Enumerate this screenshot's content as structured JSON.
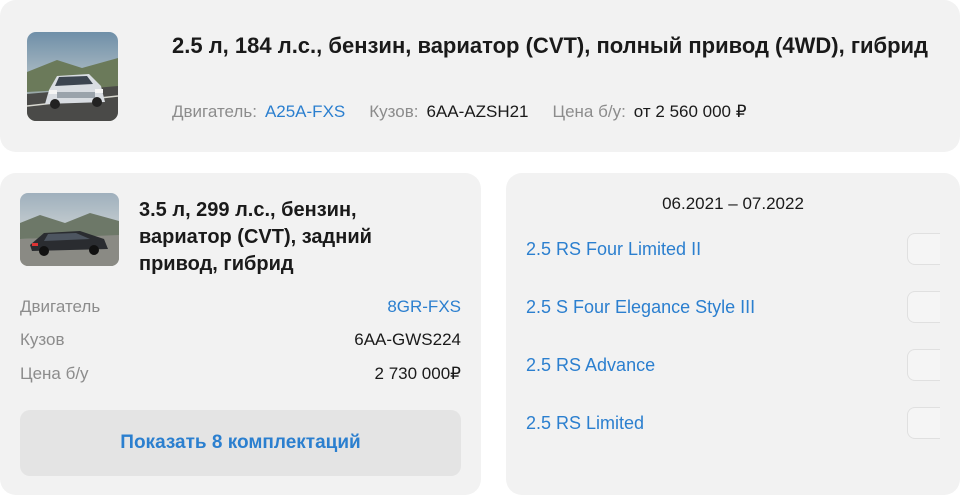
{
  "top": {
    "title": "2.5 л, 184 л.с., бензин, вариатор (CVT), полный привод (4WD), гибрид",
    "engine_label": "Двигатель:",
    "engine_value": "A25A-FXS",
    "body_label": "Кузов:",
    "body_value": "6AA-AZSH21",
    "price_label": "Цена б/у:",
    "price_value": "от 2 560 000 ₽",
    "photo_icon": "car-photo-white-sedan"
  },
  "left": {
    "title": "3.5 л, 299 л.с., бензин, вариатор (CVT), задний привод, гибрид",
    "photo_icon": "car-photo-dark-sedan",
    "specs": [
      {
        "label": "Двигатель",
        "value": "8GR-FXS"
      },
      {
        "label": "Кузов",
        "value": "6AA-GWS224"
      },
      {
        "label": "Цена б/у",
        "value": "2 730 000₽"
      }
    ],
    "button_label": "Показать 8 комплектаций"
  },
  "right": {
    "period": "06.2021 – 07.2022",
    "trims": [
      {
        "label": "2.5 RS Four Limited II"
      },
      {
        "label": "2.5 S Four Elegance Style III"
      },
      {
        "label": "2.5 RS Advance"
      },
      {
        "label": "2.5 RS Limited"
      }
    ]
  },
  "colors": {
    "link": "#2b7fcf",
    "card_bg": "#f2f2f2",
    "muted_text": "#8c8c8c",
    "button_bg": "#e4e4e4"
  }
}
